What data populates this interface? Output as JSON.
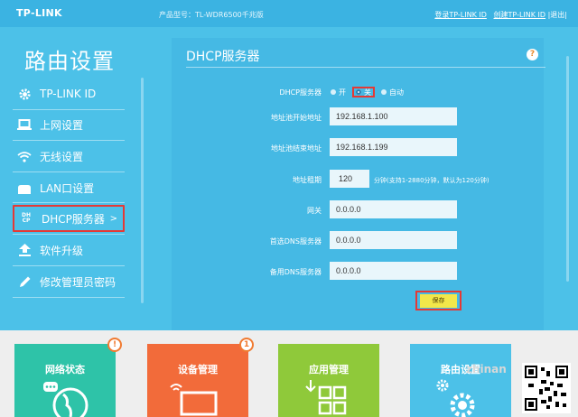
{
  "header": {
    "logo": "TP-LINK",
    "model": "产品型号：TL-WDR6500千兆版",
    "login_link": "登录TP-LINK ID",
    "create_link": "创建TP-LINK ID",
    "logout": "|退出|"
  },
  "sidebar": {
    "title": "路由设置",
    "items": [
      {
        "label": "TP-LINK ID",
        "icon": "gear-icon"
      },
      {
        "label": "上网设置",
        "icon": "laptop-icon"
      },
      {
        "label": "无线设置",
        "icon": "wifi-icon"
      },
      {
        "label": "LAN口设置",
        "icon": "router-icon"
      },
      {
        "label": "DHCP服务器",
        "icon": "dhcp-icon",
        "active": true,
        "arrow": ">"
      },
      {
        "label": "软件升级",
        "icon": "upload-icon"
      },
      {
        "label": "修改管理员密码",
        "icon": "pencil-icon"
      }
    ]
  },
  "panel": {
    "title": "DHCP服务器",
    "help": "?",
    "dhcp_label": "DHCP服务器",
    "radio_on": "开",
    "radio_off": "关",
    "radio_auto": "自动",
    "selected": "关",
    "start_label": "地址池开始地址",
    "start_value": "192.168.1.100",
    "end_label": "地址池结束地址",
    "end_value": "192.168.1.199",
    "lease_label": "地址租期",
    "lease_value": "120",
    "lease_hint": "分钟(支持1-2880分钟，默认为120分钟)",
    "gateway_label": "网关",
    "gateway_value": "0.0.0.0",
    "dns1_label": "首选DNS服务器",
    "dns1_value": "0.0.0.0",
    "dns2_label": "备用DNS服务器",
    "dns2_value": "0.0.0.0",
    "save_label": "保存"
  },
  "tiles": [
    {
      "label": "网络状态",
      "color": "#2ec3a8",
      "badge": "!"
    },
    {
      "label": "设备管理",
      "color": "#f26b3a",
      "badge": "1"
    },
    {
      "label": "应用管理",
      "color": "#8fc93a"
    },
    {
      "label": "路由设置",
      "color": "#4cc1e8"
    }
  ],
  "watermark": "zhinan"
}
